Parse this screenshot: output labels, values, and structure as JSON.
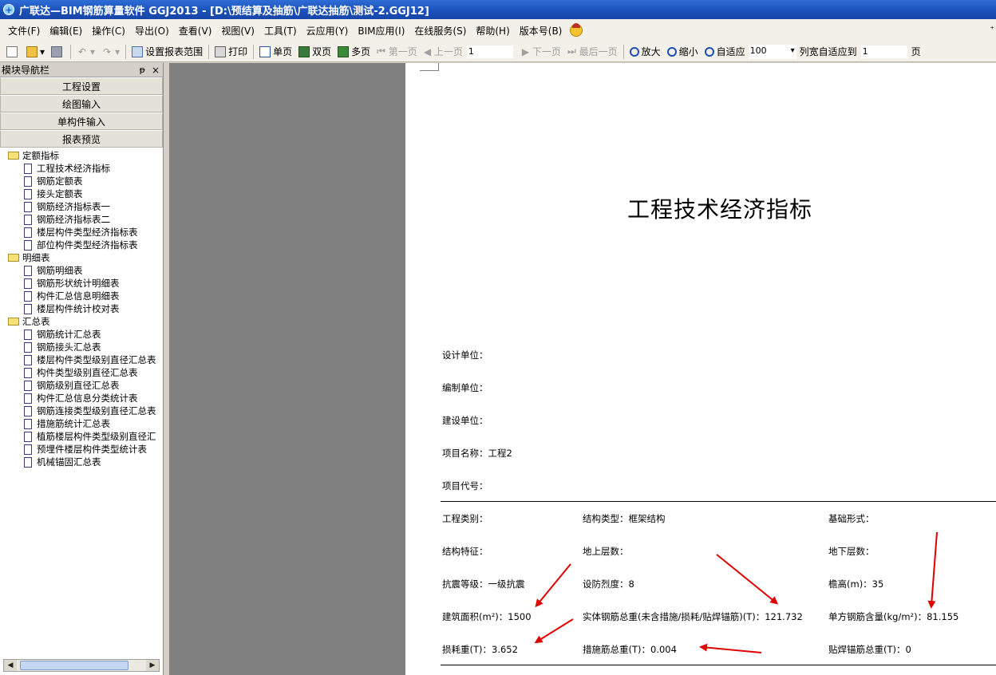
{
  "window": {
    "title": "广联达—BIM钢筋算量软件 GGJ2013 - [D:\\预结算及抽筋\\广联达抽筋\\测试-2.GGJ12]"
  },
  "menu": [
    "文件(F)",
    "编辑(E)",
    "操作(C)",
    "导出(O)",
    "查看(V)",
    "视图(V)",
    "工具(T)",
    "云应用(Y)",
    "BIM应用(I)",
    "在线服务(S)",
    "帮助(H)",
    "版本号(B)"
  ],
  "toolbar": {
    "report_range": "设置报表范围",
    "print": "打印",
    "single_page": "单页",
    "double_page": "双页",
    "multi_page": "多页",
    "first_page": "第一页",
    "prev_page": "上一页",
    "page_input": "1",
    "next_page": "下一页",
    "last_page": "最后一页",
    "zoom_in": "放大",
    "zoom_out": "缩小",
    "fit": "自适应",
    "zoom_value": "100",
    "col_fit": "列宽自适应到",
    "col_fit_value": "1",
    "page_unit": "页"
  },
  "nav": {
    "title": "模块导航栏",
    "sections": [
      "工程设置",
      "绘图输入",
      "单构件输入",
      "报表预览"
    ],
    "groups": [
      {
        "label": "定额指标",
        "items": [
          "工程技术经济指标",
          "钢筋定额表",
          "接头定额表",
          "钢筋经济指标表一",
          "钢筋经济指标表二",
          "楼层构件类型经济指标表",
          "部位构件类型经济指标表"
        ]
      },
      {
        "label": "明细表",
        "items": [
          "钢筋明细表",
          "钢筋形状统计明细表",
          "构件汇总信息明细表",
          "楼层构件统计校对表"
        ]
      },
      {
        "label": "汇总表",
        "items": [
          "钢筋统计汇总表",
          "钢筋接头汇总表",
          "楼层构件类型级别直径汇总表",
          "构件类型级别直径汇总表",
          "钢筋级别直径汇总表",
          "构件汇总信息分类统计表",
          "钢筋连接类型级别直径汇总表",
          "措施筋统计汇总表",
          "植筋楼层构件类型级别直径汇",
          "预埋件楼层构件类型统计表",
          "机械锚固汇总表"
        ]
      }
    ]
  },
  "report": {
    "title": "工程技术经济指标",
    "design_unit": "设计单位：",
    "compile_unit": "编制单位：",
    "build_unit": "建设单位：",
    "project_name": "项目名称：工程2",
    "project_code": "项目代号：",
    "project_type": "工程类别：",
    "structure_type": "结构类型：框架结构",
    "foundation": "基础形式：",
    "structure_feature": "结构特征：",
    "above_floors": "地上层数：",
    "below_floors": "地下层数：",
    "seismic_grade": "抗震等级：一级抗震",
    "seismic_intensity": "设防烈度：8",
    "eave_height": "檐高(m)：35",
    "building_area": "建筑面积(m²)：1500",
    "solid_rebar": "实体钢筋总重(未含措施/损耗/贴焊锚筋)(T)：121.732",
    "rebar_per_sqm": "单方钢筋含量(kg/m²)：81.155",
    "loss_weight": "损耗重(T)：3.652",
    "measure_rebar": "措施筋总重(T)：0.004",
    "weld_anchor": "贴焊锚筋总重(T)：0"
  },
  "colors": {
    "annotation_arrow": "#e00000",
    "titlebar": "#1a4fb8",
    "viewer_background": "#808080"
  }
}
